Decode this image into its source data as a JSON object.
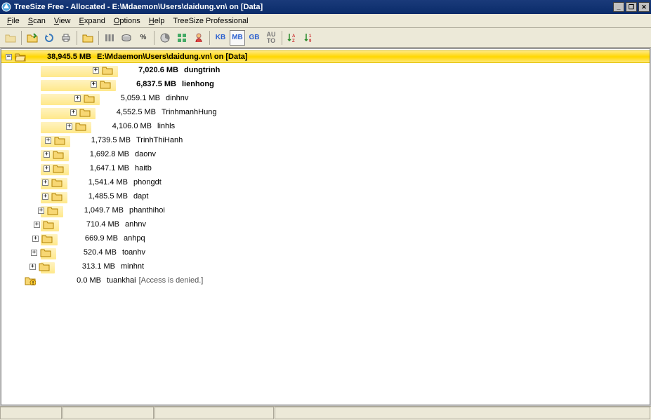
{
  "window": {
    "title": "TreeSize Free - Allocated - E:\\Mdaemon\\Users\\daidung.vn\\ on [Data]"
  },
  "menu": {
    "file": "File",
    "scan": "Scan",
    "view": "View",
    "expand": "Expand",
    "options": "Options",
    "help": "Help",
    "pro": "TreeSize Professional"
  },
  "toolbar": {
    "kb": "KB",
    "mb": "MB",
    "gb": "GB",
    "auto": "AU\nTO",
    "percent": "%",
    "sort_az": "A\nZ",
    "sort_19": "1\n9"
  },
  "root": {
    "size": "38,945.5 MB",
    "path": "E:\\Mdaemon\\Users\\daidung.vn\\ on [Data]"
  },
  "items": [
    {
      "size": "7,020.6 MB",
      "name": "dungtrinh",
      "bold": true,
      "bar": 110,
      "expandable": true
    },
    {
      "size": "6,837.5 MB",
      "name": "lienhong",
      "bold": true,
      "bar": 107,
      "expandable": true
    },
    {
      "size": "5,059.1 MB",
      "name": "dinhnv",
      "bold": false,
      "bar": 84,
      "expandable": true
    },
    {
      "size": "4,552.5 MB",
      "name": "TrinhmanhHung",
      "bold": false,
      "bar": 78,
      "expandable": true
    },
    {
      "size": "4,106.0 MB",
      "name": "linhls",
      "bold": false,
      "bar": 72,
      "expandable": true
    },
    {
      "size": "1,739.5 MB",
      "name": "TrinhThiHanh",
      "bold": false,
      "bar": 42,
      "expandable": true
    },
    {
      "size": "1,692.8 MB",
      "name": "daonv",
      "bold": false,
      "bar": 40,
      "expandable": true
    },
    {
      "size": "1,647.1 MB",
      "name": "haitb",
      "bold": false,
      "bar": 40,
      "expandable": true
    },
    {
      "size": "1,541.4 MB",
      "name": "phongdt",
      "bold": false,
      "bar": 38,
      "expandable": true
    },
    {
      "size": "1,485.5 MB",
      "name": "dapt",
      "bold": false,
      "bar": 38,
      "expandable": true
    },
    {
      "size": "1,049.7 MB",
      "name": "phanthihoi",
      "bold": false,
      "bar": 32,
      "expandable": true
    },
    {
      "size": "710.4 MB",
      "name": "anhnv",
      "bold": false,
      "bar": 26,
      "expandable": true
    },
    {
      "size": "669.9 MB",
      "name": "anhpq",
      "bold": false,
      "bar": 24,
      "expandable": true
    },
    {
      "size": "520.4 MB",
      "name": "toanhv",
      "bold": false,
      "bar": 22,
      "expandable": true
    },
    {
      "size": "313.1 MB",
      "name": "minhnt",
      "bold": false,
      "bar": 20,
      "expandable": true
    },
    {
      "size": "0.0 MB",
      "name": "tuankhai",
      "bold": false,
      "bar": 0,
      "expandable": false,
      "note": "[Access is denied.]",
      "warn": true
    }
  ]
}
